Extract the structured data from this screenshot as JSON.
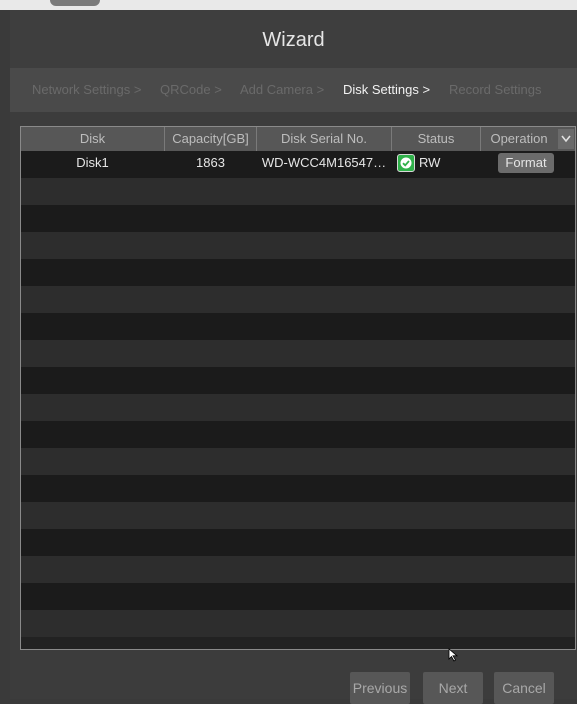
{
  "dialog": {
    "title": "Wizard"
  },
  "steps": [
    {
      "label": "Network Settings >",
      "active": false
    },
    {
      "label": "QRCode >",
      "active": false
    },
    {
      "label": "Add Camera >",
      "active": false
    },
    {
      "label": "Disk Settings >",
      "active": true
    },
    {
      "label": "Record Settings",
      "active": false
    }
  ],
  "table": {
    "columns": [
      "Disk",
      "Capacity[GB]",
      "Disk Serial No.",
      "Status",
      "Operation"
    ],
    "rows": [
      {
        "disk": "Disk1",
        "capacity": "1863",
        "serial": "WD-WCC4M16547…",
        "status": "RW",
        "operation": "Format"
      }
    ]
  },
  "buttons": {
    "previous": "Previous",
    "next": "Next",
    "cancel": "Cancel"
  },
  "icons": {
    "status": "check-circle-icon",
    "sort": "chevron-down-icon",
    "cursor": "mouse-pointer-icon"
  },
  "colors": {
    "status_ok": "#2fb04a",
    "active_step": "#f2f2f2",
    "inactive_step": "#6a6a6a"
  }
}
